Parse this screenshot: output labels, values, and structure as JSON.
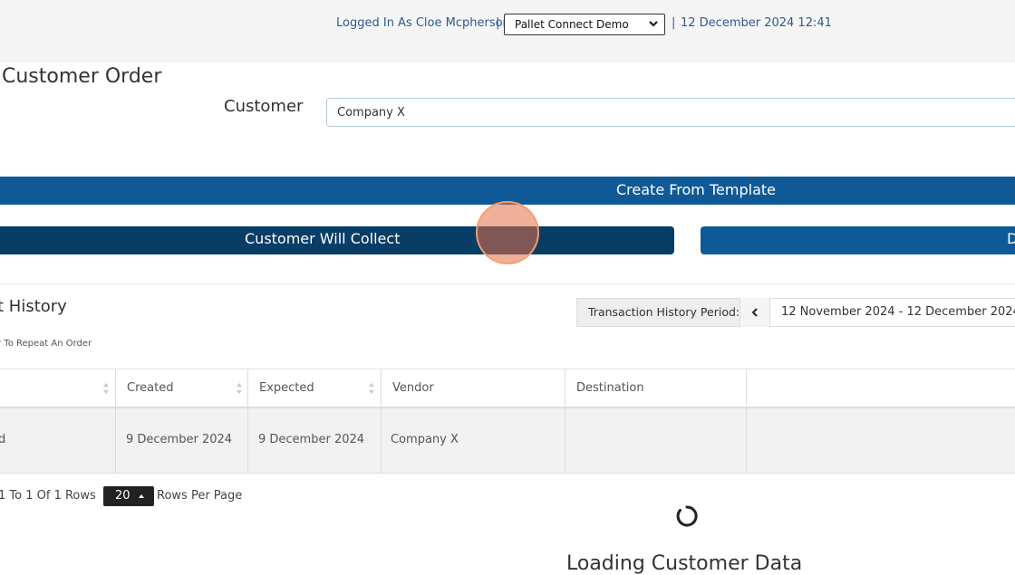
{
  "header": {
    "logged_in": "Logged In As Cloe Mcpherson",
    "separator": "|",
    "tenant_selected": "Pallet Connect Demo",
    "datetime": "12 December 2024 12:41"
  },
  "page": {
    "title": "Customer Order",
    "customer_label": "Customer",
    "customer_value": "Company X"
  },
  "buttons": {
    "create_from_template": "Create From Template",
    "customer_will_collect": "Customer Will Collect",
    "delivery_partial": "D"
  },
  "history": {
    "title": "t History",
    "hint": "r To Repeat An Order",
    "period_label": "Transaction History Period:",
    "period_range": "12 November 2024 - 12 December 2024",
    "columns": [
      "",
      "Created",
      "Expected",
      "Vendor",
      "Destination",
      ""
    ],
    "rows": [
      [
        "d",
        "9 December 2024",
        "9 December 2024",
        "Company X",
        "",
        ""
      ]
    ]
  },
  "pagination": {
    "info": "1 To 1 Of 1 Rows",
    "page_size": "20",
    "rows_per_page": "Rows Per Page"
  },
  "loading": {
    "text": "Loading Customer Data"
  },
  "colors": {
    "primary_blue": "#0f5a96",
    "dark_blue": "#083d66",
    "link_blue": "#2e5a8c"
  },
  "icons": [
    "chevron-down-icon",
    "chevron-left-icon",
    "sort-icon",
    "caret-up-icon",
    "spinner-icon"
  ]
}
